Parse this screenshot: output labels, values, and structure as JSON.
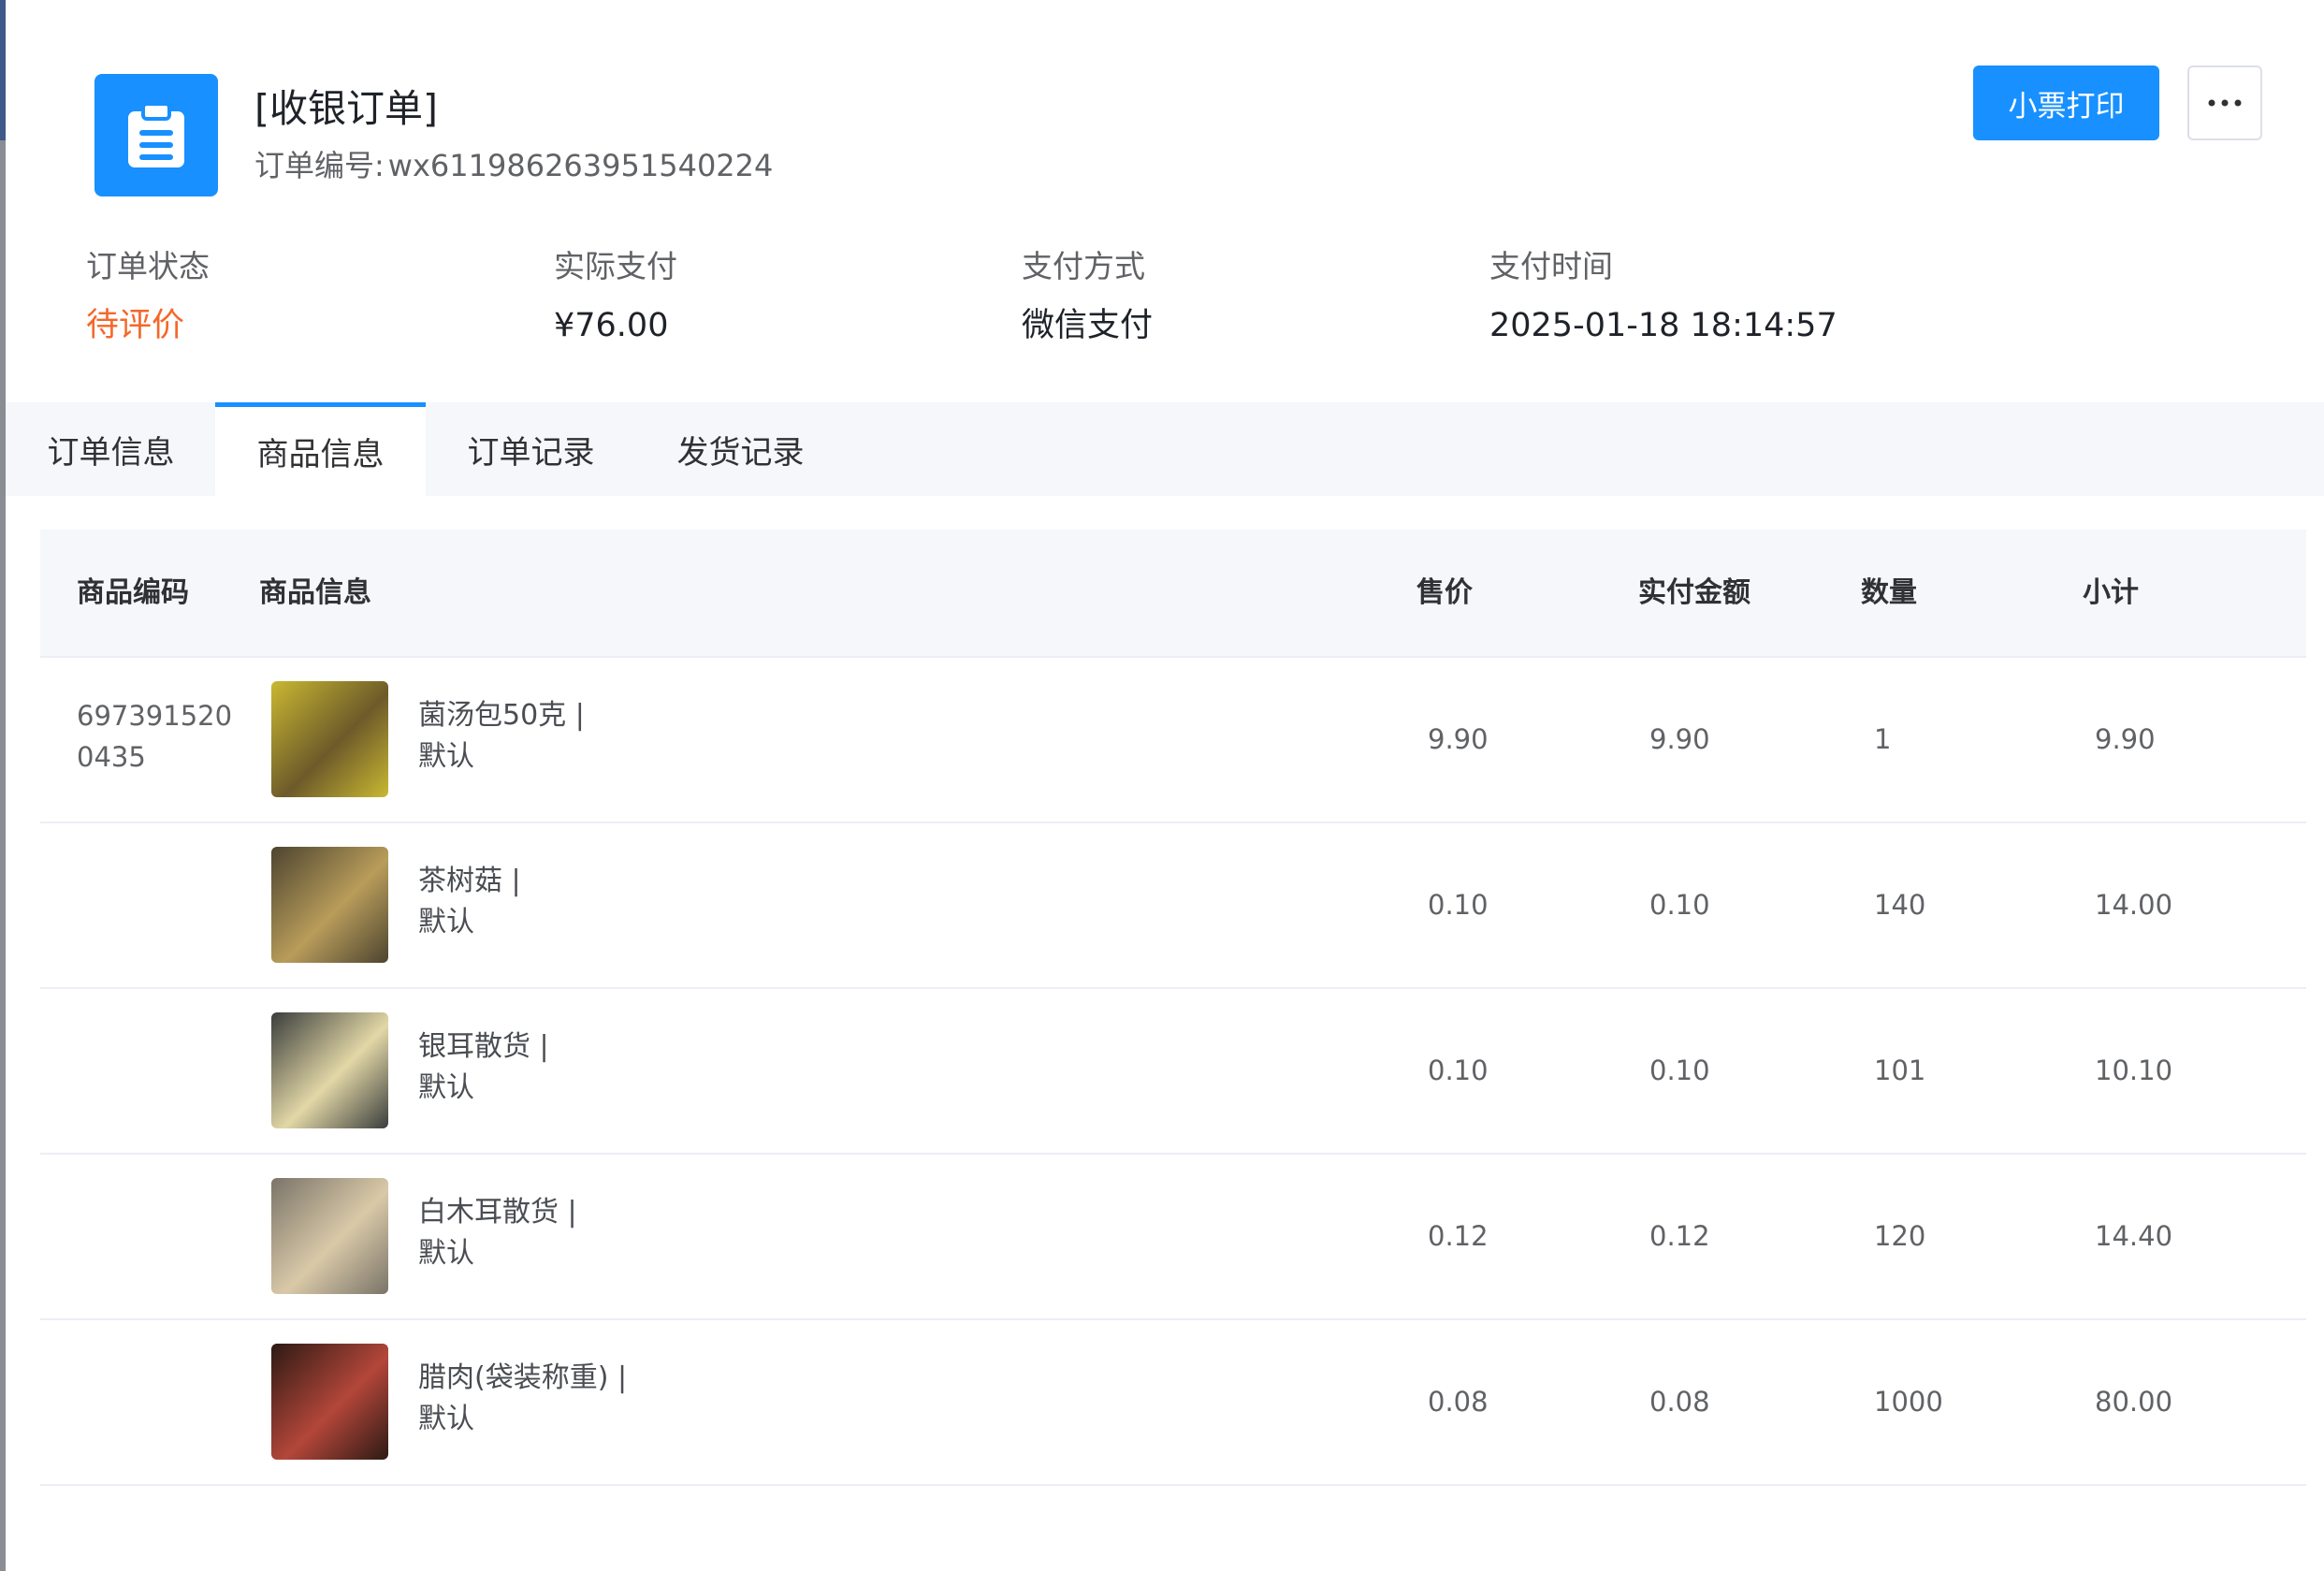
{
  "header": {
    "icon": "clipboard-icon",
    "title": "[收银订单]",
    "order_no_label": "订单编号:",
    "order_no": "wx611986263951540224",
    "print_button": "小票打印",
    "more_icon": "ellipsis-icon"
  },
  "summary": [
    {
      "label": "订单状态",
      "value": "待评价",
      "value_color": "#f5672a"
    },
    {
      "label": "实际支付",
      "value": "¥76.00"
    },
    {
      "label": "支付方式",
      "value": "微信支付"
    },
    {
      "label": "支付时间",
      "value": "2025-01-18 18:14:57"
    }
  ],
  "tabs": [
    {
      "label": "订单信息",
      "active": false
    },
    {
      "label": "商品信息",
      "active": true
    },
    {
      "label": "订单记录",
      "active": false
    },
    {
      "label": "发货记录",
      "active": false
    }
  ],
  "table": {
    "columns": [
      "商品编码",
      "商品信息",
      "售价",
      "实付金额",
      "数量",
      "小计"
    ],
    "rows": [
      {
        "code": "6973915200435",
        "name": "菌汤包50克 |",
        "spec": "默认",
        "price": "9.90",
        "paid": "9.90",
        "qty": "1",
        "subtotal": "9.90",
        "thumb_colors": [
          "#c9b832",
          "#6d5a2a"
        ]
      },
      {
        "code": "",
        "name": "茶树菇 |",
        "spec": "默认",
        "price": "0.10",
        "paid": "0.10",
        "qty": "140",
        "subtotal": "14.00",
        "thumb_colors": [
          "#4d4430",
          "#b89c5a"
        ]
      },
      {
        "code": "",
        "name": "银耳散货 |",
        "spec": "默认",
        "price": "0.10",
        "paid": "0.10",
        "qty": "101",
        "subtotal": "10.10",
        "thumb_colors": [
          "#3a3d3c",
          "#e2d7a6"
        ]
      },
      {
        "code": "",
        "name": "白木耳散货 |",
        "spec": "默认",
        "price": "0.12",
        "paid": "0.12",
        "qty": "120",
        "subtotal": "14.40",
        "thumb_colors": [
          "#7a7468",
          "#d9c9a8"
        ]
      },
      {
        "code": "",
        "name": "腊肉(袋装称重) |",
        "spec": "默认",
        "price": "0.08",
        "paid": "0.08",
        "qty": "1000",
        "subtotal": "80.00",
        "thumb_colors": [
          "#2c1a14",
          "#b4463a"
        ]
      }
    ]
  }
}
